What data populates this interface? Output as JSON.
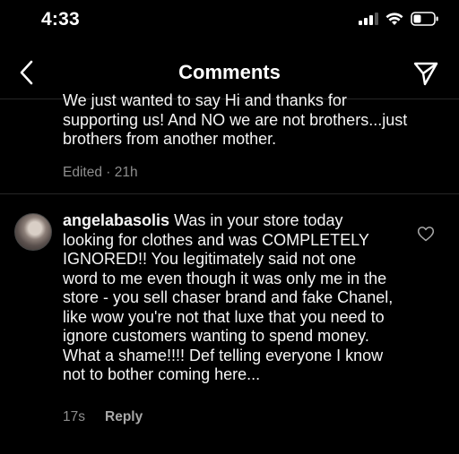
{
  "status_bar": {
    "time": "4:33",
    "icons": [
      "signal-icon",
      "wifi-icon",
      "battery-icon"
    ]
  },
  "nav": {
    "title": "Comments",
    "back_icon": "chevron-left-icon",
    "send_icon": "paper-plane-icon"
  },
  "comments": [
    {
      "text": "We just wanted to say Hi and thanks for supporting us! And NO we are not brothers...just brothers from another mother.",
      "edited": "Edited",
      "time": "21h"
    },
    {
      "username": "angelabasolis",
      "text": "Was in your store today looking for clothes and was COMPLETELY IGNORED!! You legitimately said not one word to me even though it was only me in the store - you sell chaser brand and fake Chanel, like wow you're not that luxe that you need to ignore customers wanting to spend money. What a shame!!!! Def telling everyone I know not to bother coming here...",
      "time": "17s",
      "reply_label": "Reply",
      "like_icon": "heart-outline-icon"
    }
  ],
  "colors": {
    "background": "#000000",
    "text": "#f5f5f5",
    "meta_text": "#8e8e8e",
    "divider": "#262626"
  }
}
